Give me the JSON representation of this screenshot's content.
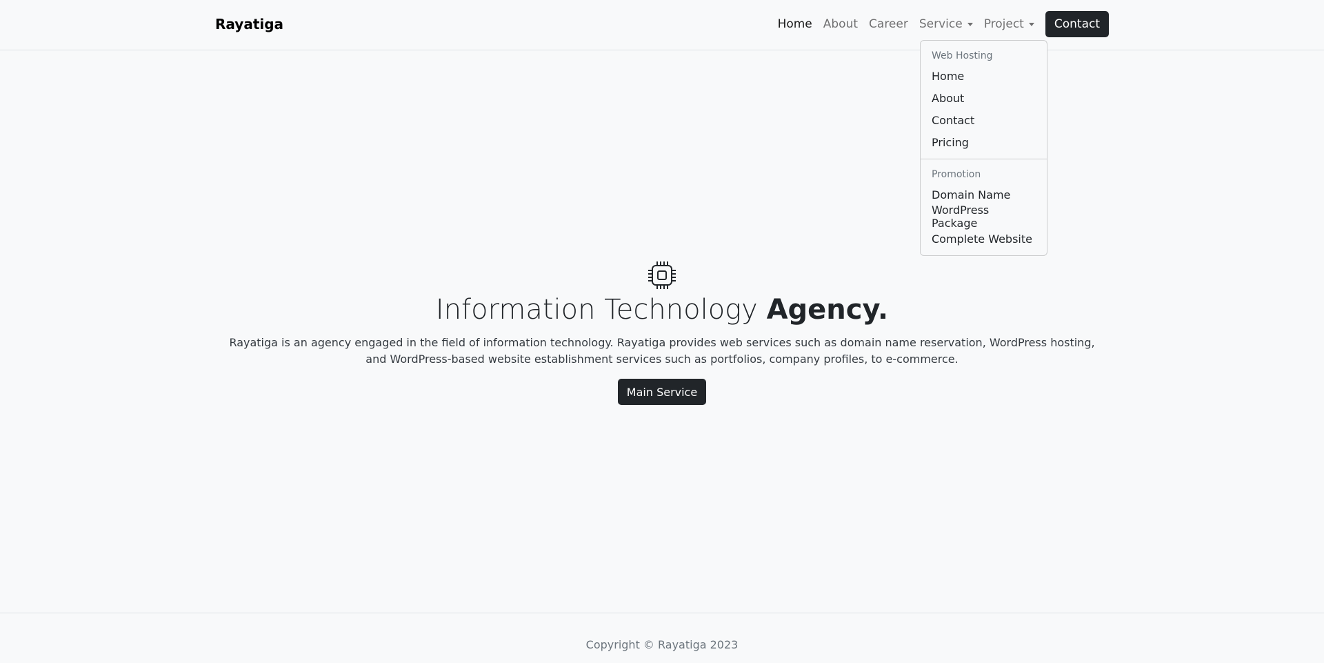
{
  "navbar": {
    "brand": "Rayatiga",
    "links": {
      "home": "Home",
      "about": "About",
      "career": "Career",
      "service": "Service",
      "project": "Project"
    },
    "contact_button": "Contact"
  },
  "dropdown": {
    "header_1": "Web Hosting",
    "items_1": [
      "Home",
      "About",
      "Contact",
      "Pricing"
    ],
    "header_2": "Promotion",
    "items_2": [
      "Domain Name",
      "WordPress Package",
      "Complete Website"
    ]
  },
  "hero": {
    "icon": "cpu-icon",
    "title_light": "Information Technology ",
    "title_bold": "Agency.",
    "description": "Rayatiga is an agency engaged in the field of information technology. Rayatiga provides web services such as domain name reservation, WordPress hosting, and WordPress-based website establishment services such as portfolios, company profiles, to e-commerce.",
    "button": "Main Service"
  },
  "footer": {
    "copyright": "Copyright © Rayatiga 2023"
  }
}
